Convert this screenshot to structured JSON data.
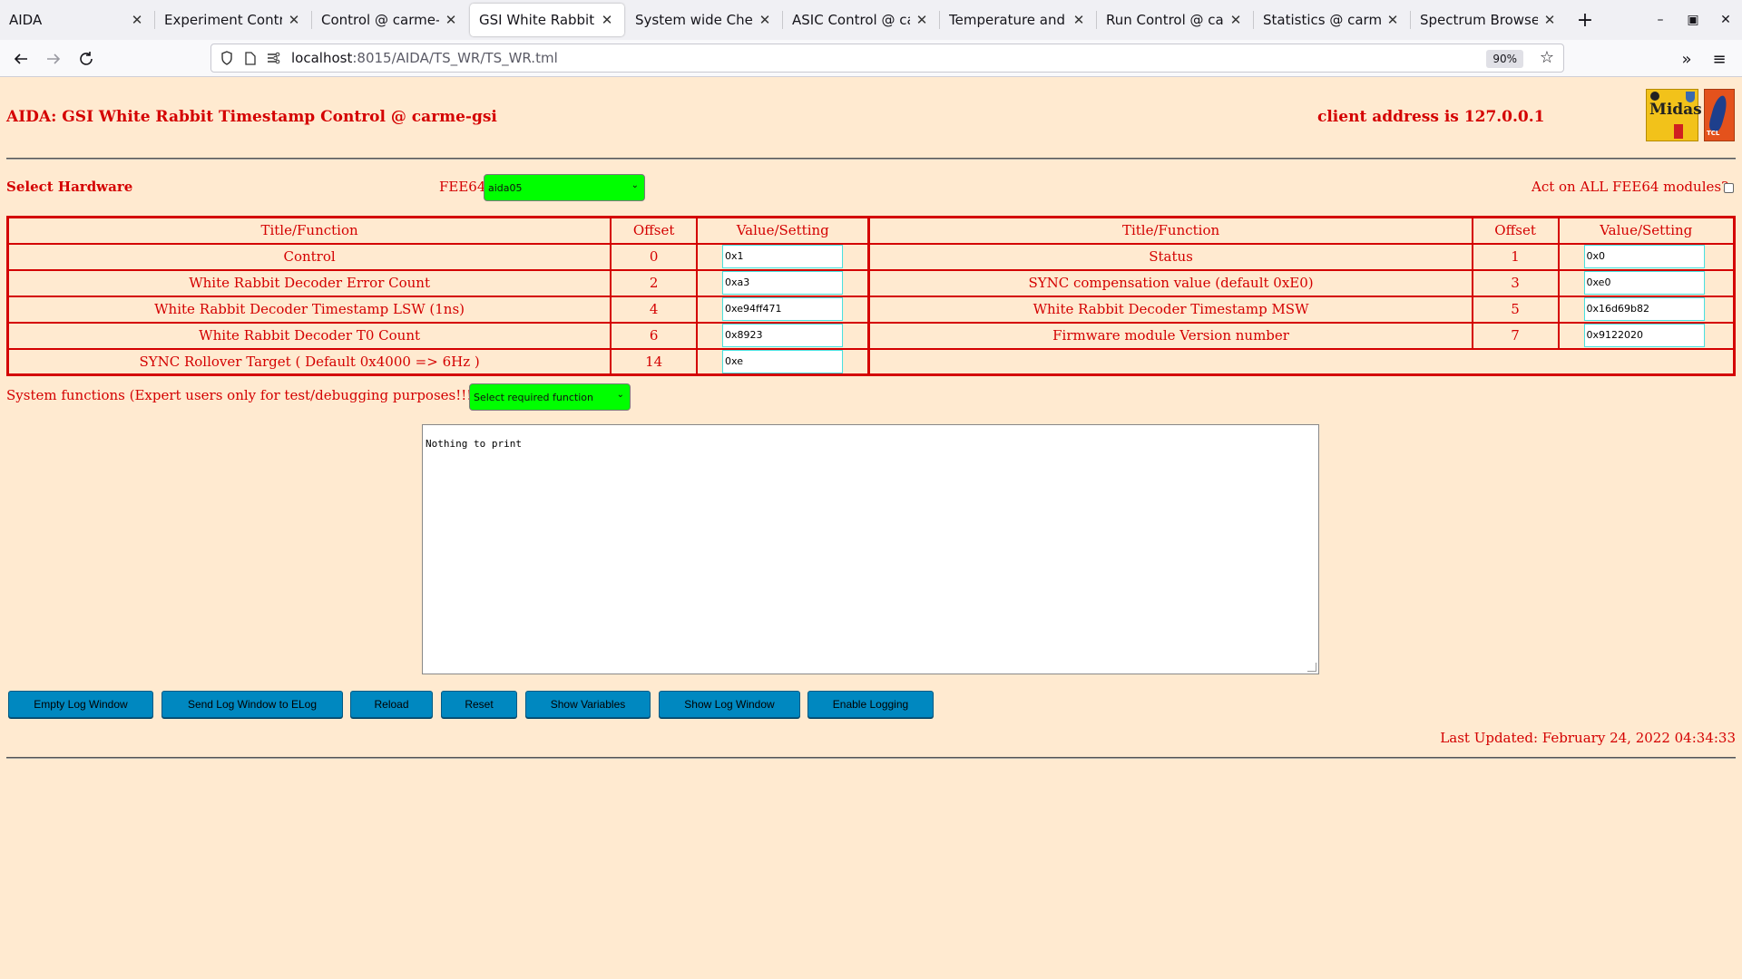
{
  "browser": {
    "tabs": [
      {
        "label": "AIDA",
        "active": false
      },
      {
        "label": "Experiment Control @",
        "active": false
      },
      {
        "label": "Control @ carme-gsi",
        "active": false
      },
      {
        "label": "GSI White Rabbit Tim",
        "active": true
      },
      {
        "label": "System wide Checks",
        "active": false
      },
      {
        "label": "ASIC Control @ carm",
        "active": false
      },
      {
        "label": "Temperature and stat",
        "active": false
      },
      {
        "label": "Run Control @ carme",
        "active": false
      },
      {
        "label": "Statistics @ carme-g",
        "active": false
      },
      {
        "label": "Spectrum Browser @",
        "active": false
      }
    ],
    "new_tab": "+",
    "url_host": "localhost",
    "url_path": ":8015/AIDA/TS_WR/TS_WR.tml",
    "zoom": "90%"
  },
  "page": {
    "title": "AIDA: GSI White Rabbit Timestamp Control @ carme-gsi",
    "client_address": "client address is 127.0.0.1",
    "midas_logo_text": "Midas",
    "tcl_logo_text": "TCL POWERED",
    "select_hardware_label": "Select Hardware",
    "fee_label": "FEE64",
    "fee_selected": "aida05",
    "act_all_label": "Act on ALL FEE64 modules?",
    "table": {
      "headers": {
        "title": "Title/Function",
        "offset": "Offset",
        "value": "Value/Setting"
      },
      "rows": [
        {
          "left": {
            "title": "Control",
            "offset": "0",
            "value": "0x1"
          },
          "right": {
            "title": "Status",
            "offset": "1",
            "value": "0x0"
          }
        },
        {
          "left": {
            "title": "White Rabbit Decoder Error Count",
            "offset": "2",
            "value": "0xa3"
          },
          "right": {
            "title": "SYNC compensation value (default 0xE0)",
            "offset": "3",
            "value": "0xe0"
          }
        },
        {
          "left": {
            "title": "White Rabbit Decoder Timestamp LSW (1ns)",
            "offset": "4",
            "value": "0xe94ff471"
          },
          "right": {
            "title": "White Rabbit Decoder Timestamp MSW",
            "offset": "5",
            "value": "0x16d69b82"
          }
        },
        {
          "left": {
            "title": "White Rabbit Decoder T0 Count",
            "offset": "6",
            "value": "0x8923"
          },
          "right": {
            "title": "Firmware module Version number",
            "offset": "7",
            "value": "0x9122020"
          }
        },
        {
          "left": {
            "title": "SYNC Rollover Target ( Default 0x4000 => 6Hz )",
            "offset": "14",
            "value": "0xe"
          }
        }
      ]
    },
    "system_functions_label": "System functions (Expert users only for test/debugging purposes!!!)",
    "system_functions_selected": "Select required function",
    "log_text": "Nothing to print",
    "buttons": {
      "empty_log": "Empty Log Window",
      "send_log": "Send Log Window to ELog",
      "reload": "Reload",
      "reset": "Reset",
      "show_variables": "Show Variables",
      "show_log": "Show Log Window",
      "enable_logging": "Enable Logging"
    },
    "last_updated": "Last Updated: February 24, 2022 04:34:33"
  },
  "colors": {
    "page_background": "#ffead0",
    "text_red": "#d40000",
    "select_green": "#00ff00",
    "button_blue": "#0088c0"
  }
}
